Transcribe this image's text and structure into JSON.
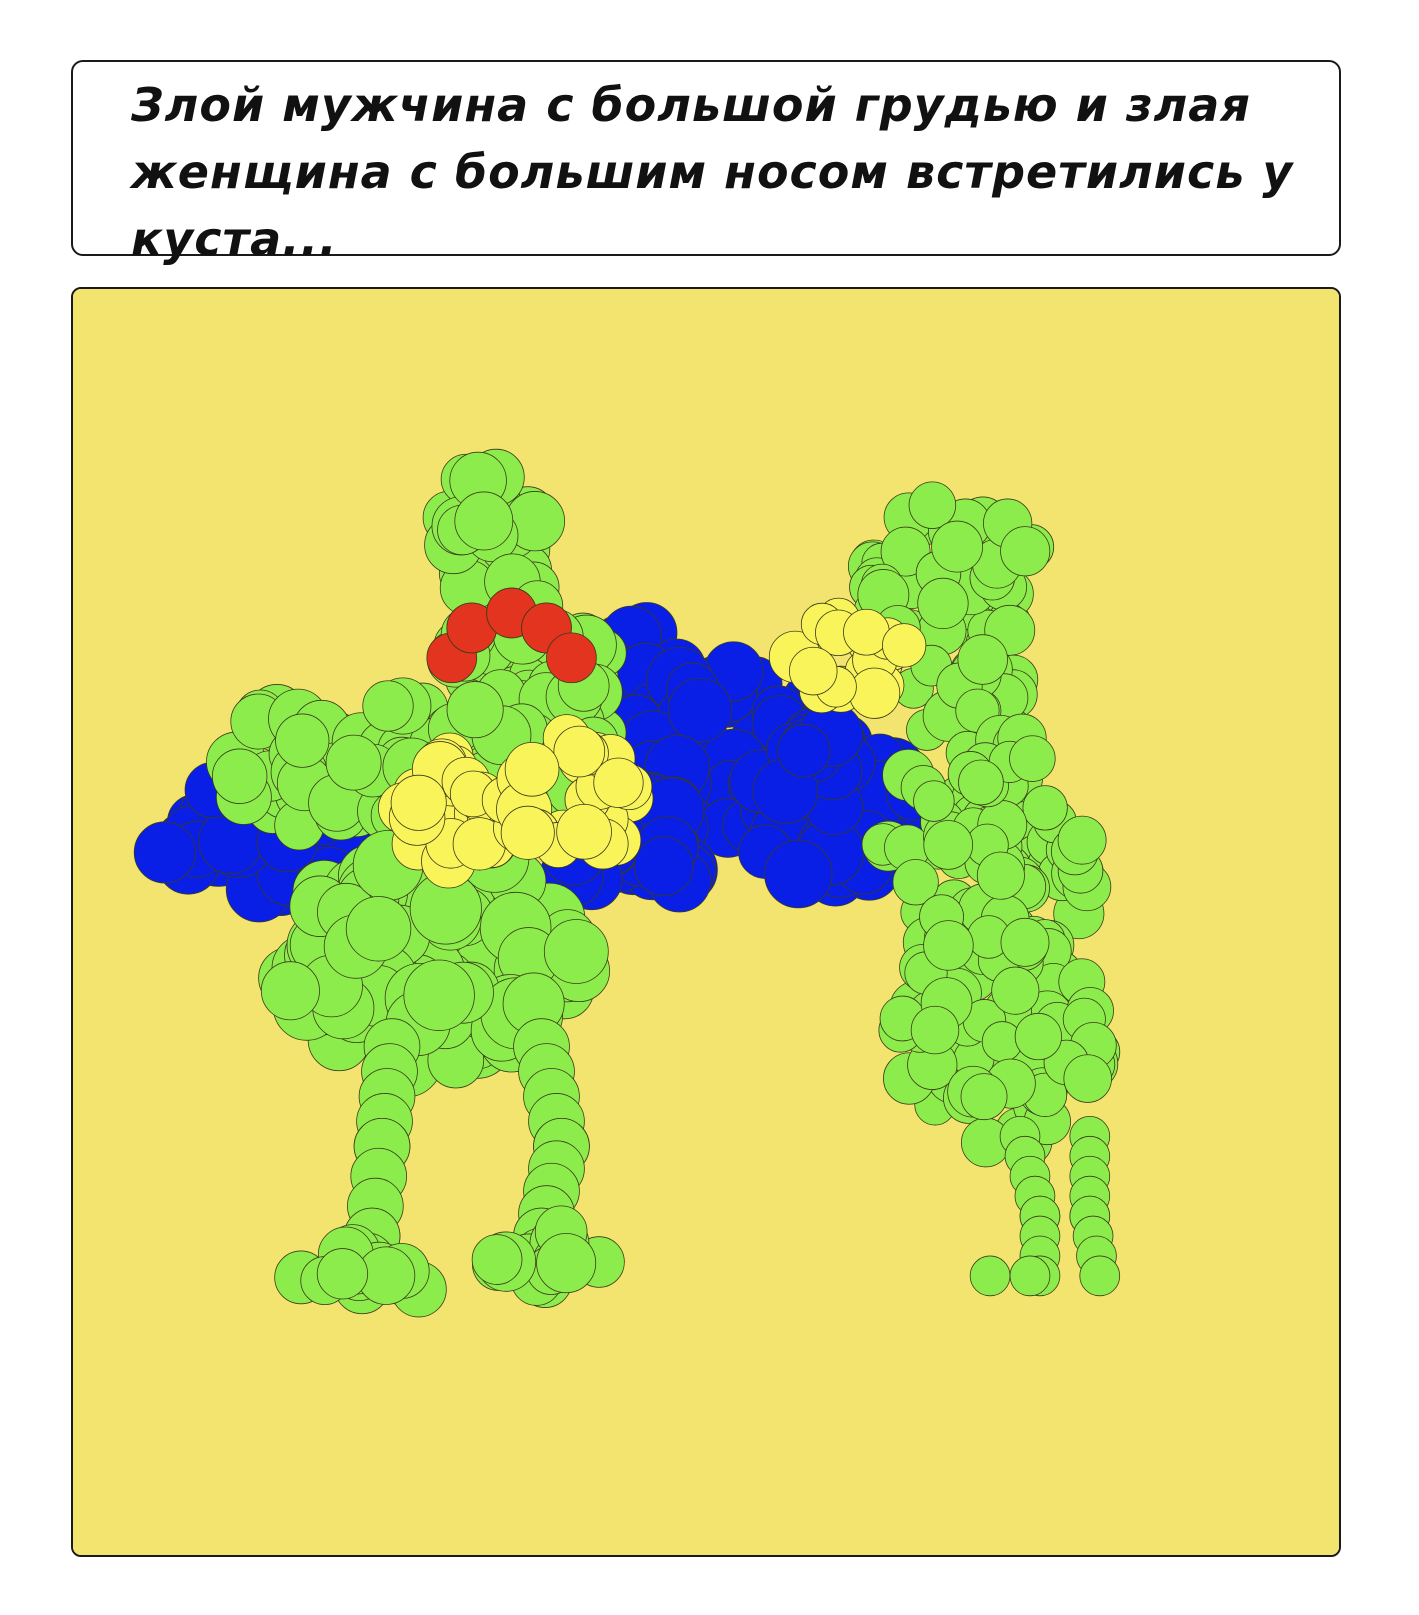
{
  "caption": {
    "text": "Злой мужчина с большой грудью и злая женщина с большим носом встретились у куста..."
  },
  "scene": {
    "background_color": "#F2E46E",
    "palette": {
      "green": "#8CEC4C",
      "blue": "#0A1FE6",
      "yellow": "#F8F45A",
      "red": "#E3341F",
      "stroke": "#3a3a1a"
    },
    "figures": [
      {
        "name": "bush",
        "color": "blue"
      },
      {
        "name": "angry-man",
        "color": "green"
      },
      {
        "name": "angry-woman",
        "color": "green"
      },
      {
        "name": "man-chest",
        "color": "yellow"
      },
      {
        "name": "woman-nose",
        "color": "yellow"
      },
      {
        "name": "man-eyebrow",
        "color": "red"
      }
    ]
  }
}
